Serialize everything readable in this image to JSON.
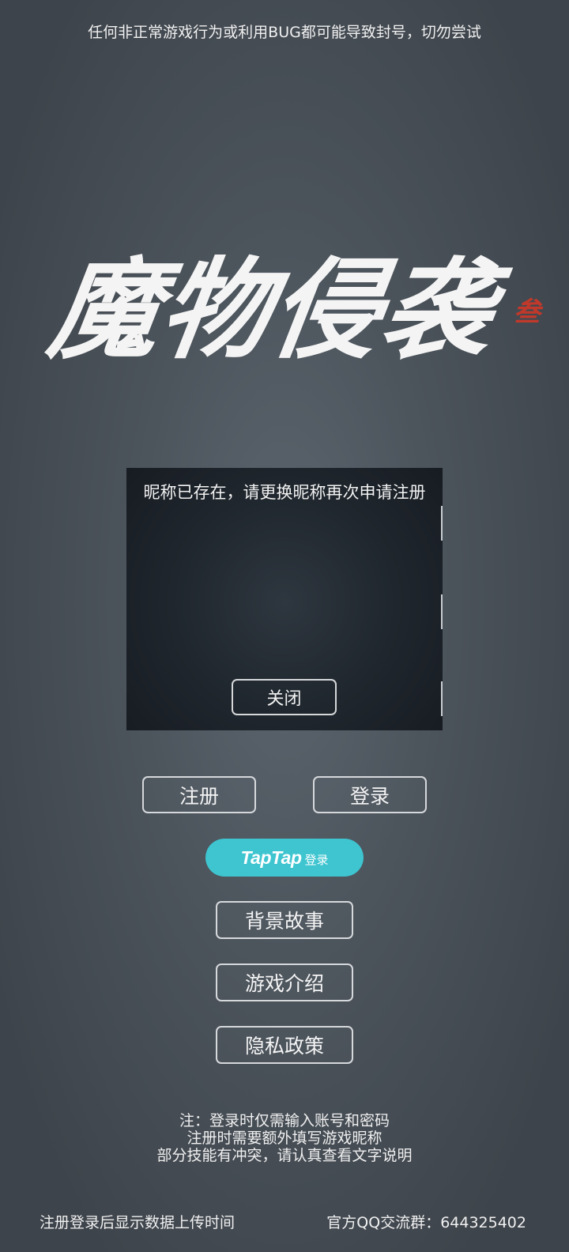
{
  "warning": "任何非正常游戏行为或利用BUG都可能导致封号，切勿尝试",
  "logo": {
    "title": "魔物侵袭",
    "edition_mark": "叁",
    "title_color": "#f4f4f4",
    "mark_color": "#c0392b"
  },
  "dialog": {
    "message": "昵称已存在，请更换昵称再次申请注册",
    "close_label": "关闭"
  },
  "buttons": {
    "register": "注册",
    "login": "登录",
    "taptap_brand": "TapTap",
    "taptap_login": "登录",
    "story": "背景故事",
    "intro": "游戏介绍",
    "privacy": "隐私政策"
  },
  "notes": [
    "注：登录时仅需输入账号和密码",
    "注册时需要额外填写游戏昵称",
    "部分技能有冲突，请认真查看文字说明"
  ],
  "footer": {
    "left": "注册登录后显示数据上传时间",
    "right": "官方QQ交流群：644325402"
  },
  "colors": {
    "taptap_accent": "#3ec5d0",
    "dialog_bg": "#1f262d"
  }
}
